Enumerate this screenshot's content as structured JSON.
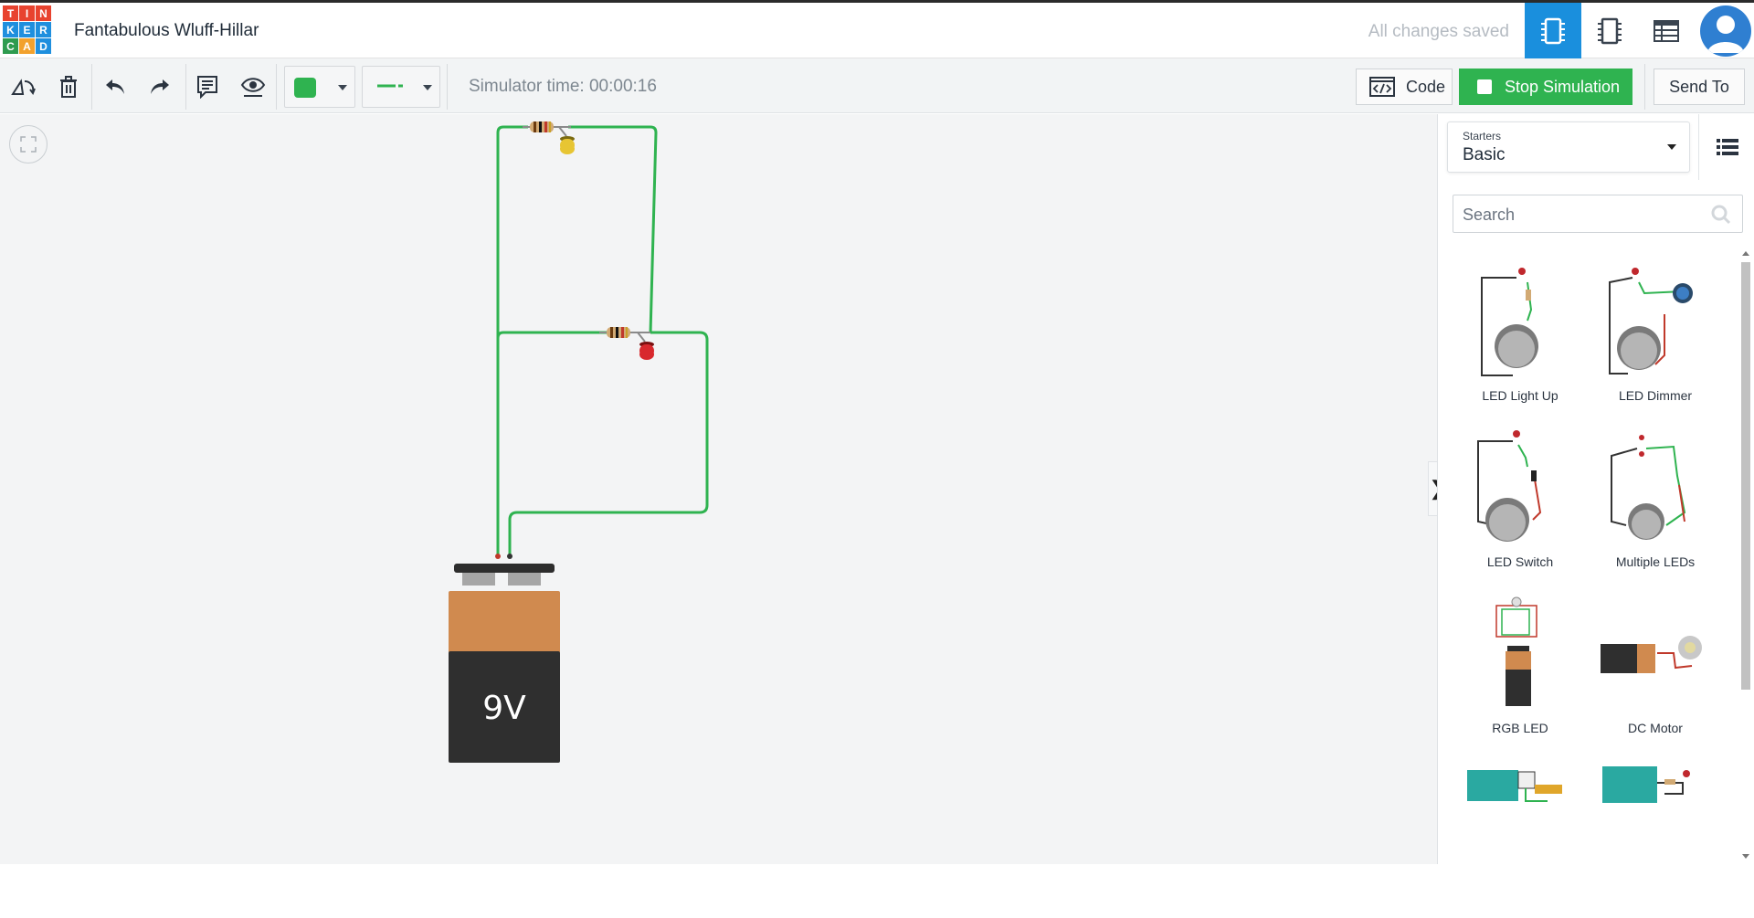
{
  "header": {
    "logo_letters": [
      "T",
      "I",
      "N",
      "K",
      "E",
      "R",
      "C",
      "A",
      "D"
    ],
    "logo_colors": [
      "#e8432f",
      "#e8432f",
      "#e8432f",
      "#1f8fde",
      "#1f8fde",
      "#1f8fde",
      "#2e9b4f",
      "#f2a12d",
      "#1f8fde"
    ],
    "project_title": "Fantabulous Wluff-Hillar",
    "save_status": "All changes saved"
  },
  "toolbar": {
    "sim_time_label": "Simulator time: 00:00:16",
    "wire_color": "#2fb350",
    "code_label": "Code",
    "stop_label": "Stop Simulation",
    "send_label": "Send To"
  },
  "circuit": {
    "battery_label": "9V"
  },
  "panel": {
    "starters_label": "Starters",
    "starters_value": "Basic",
    "search_placeholder": "Search",
    "items": [
      {
        "label": "LED Light Up"
      },
      {
        "label": "LED Dimmer"
      },
      {
        "label": "LED Switch"
      },
      {
        "label": "Multiple LEDs"
      },
      {
        "label": "RGB LED"
      },
      {
        "label": "DC Motor"
      },
      {
        "label": ""
      },
      {
        "label": ""
      }
    ]
  },
  "colors": {
    "accent_blue": "#1a8fdd",
    "sim_green": "#2fb350"
  }
}
